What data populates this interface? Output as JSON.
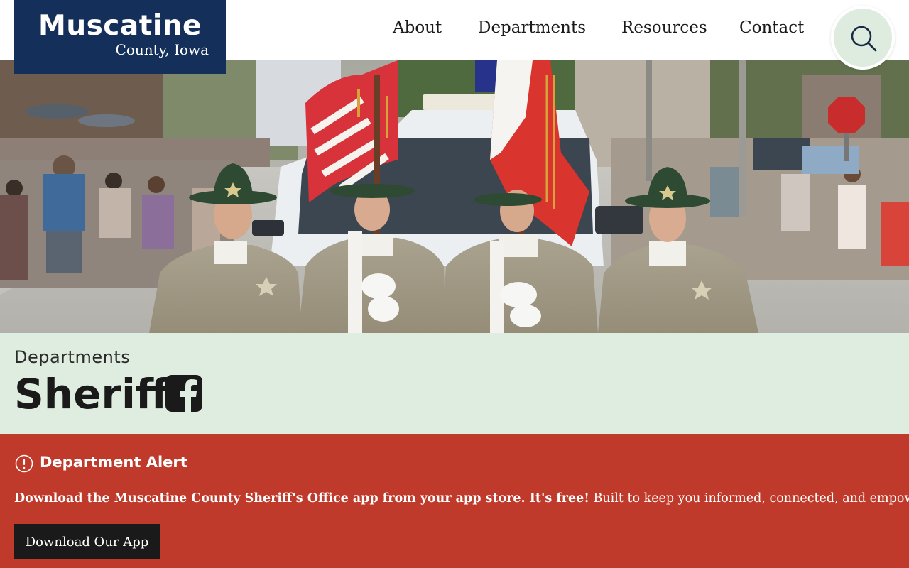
{
  "site": {
    "logo_title": "Muscatine",
    "logo_subtitle": "County, Iowa"
  },
  "nav": {
    "about": "About",
    "departments": "Departments",
    "resources": "Resources",
    "contact": "Contact",
    "search_icon": "search-icon"
  },
  "page": {
    "breadcrumb": "Departments",
    "title": "Sheriff",
    "social_icon": "facebook-icon"
  },
  "alert": {
    "icon": "exclamation-circle-icon",
    "title": "Department Alert",
    "text_bold": "Download the Muscatine County Sheriff's Office app from your app store. It's free!",
    "text_regular": " Built to keep you informed, connected, and empowered!",
    "button_label": "Download Our App"
  },
  "colors": {
    "brand_navy": "#14305a",
    "title_band_green": "#deeddf",
    "alert_red": "#bf3a2a",
    "button_dark": "#1a1a1a"
  }
}
